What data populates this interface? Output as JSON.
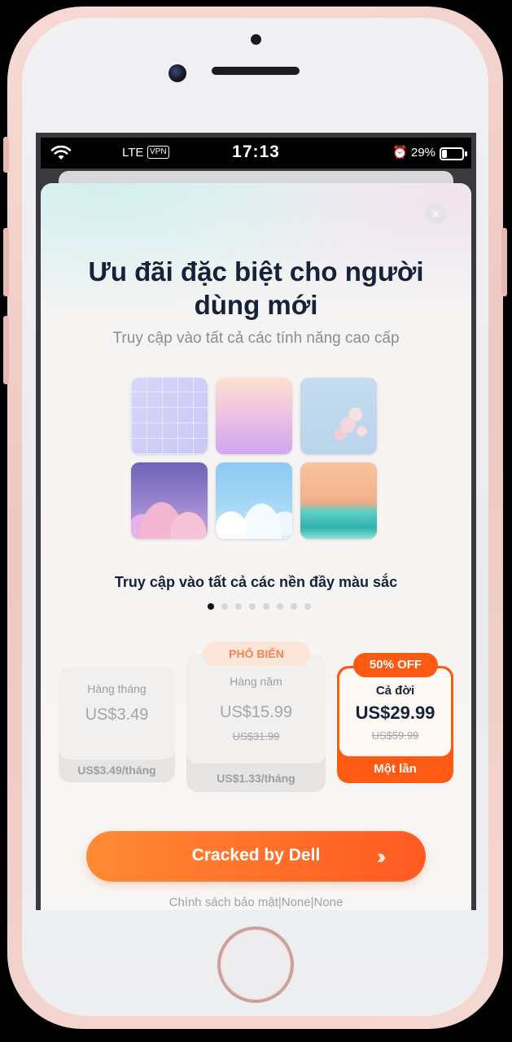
{
  "status_bar": {
    "network": "LTE",
    "vpn": "VPN",
    "time": "17:13",
    "battery": "29%",
    "battery_level": 0.29
  },
  "modal": {
    "close_icon": "close-icon",
    "title": "Ưu đãi đặc biệt cho người dùng mới",
    "subtitle": "Truy cập vào tất cả các tính năng cao cấp",
    "gallery": {
      "images": [
        {
          "name": "grid-lavender-wallpaper"
        },
        {
          "name": "peach-purple-gradient-wallpaper"
        },
        {
          "name": "cherry-blossom-wallpaper"
        },
        {
          "name": "purple-clouds-wallpaper"
        },
        {
          "name": "blue-clouds-wallpaper"
        },
        {
          "name": "beach-sunset-wallpaper"
        }
      ],
      "caption": "Truy cập vào tất cả các nền đầy màu sắc",
      "page_count": 8,
      "active_page": 1
    },
    "plans": {
      "monthly": {
        "name": "Hàng tháng",
        "price": "US$3.49",
        "footer": "US$3.49/tháng"
      },
      "yearly": {
        "badge": "PHỔ BIẾN",
        "name": "Hàng năm",
        "price": "US$15.99",
        "old_price": "US$31.99",
        "footer": "US$1.33/tháng"
      },
      "lifetime": {
        "badge": "50% OFF",
        "name": "Cả đời",
        "price": "US$29.99",
        "old_price": "US$59.99",
        "footer": "Một lần",
        "selected": true
      }
    },
    "cta": {
      "label": "Cracked by Dell",
      "icon": "double-chevron-right-icon"
    },
    "footer_links": "Chính sách bảo mật|None|None"
  },
  "colors": {
    "accent": "#FF5A13",
    "title": "#15223A",
    "popular_badge_bg": "#FBE5D8",
    "popular_badge_text": "#EF8556"
  }
}
